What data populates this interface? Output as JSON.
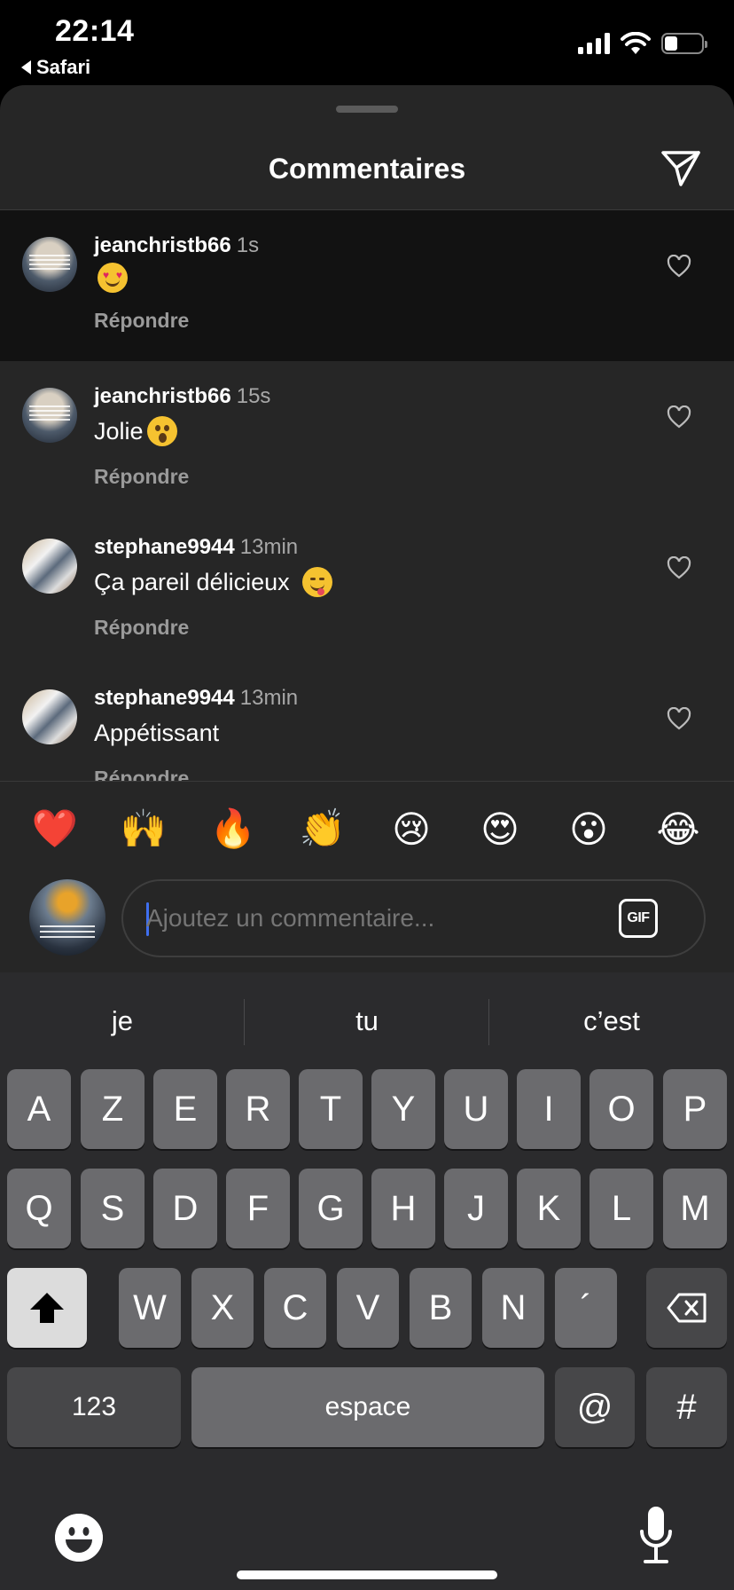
{
  "status_bar": {
    "time": "22:14",
    "back_app": "Safari",
    "battery_level": 0.35
  },
  "sheet": {
    "title": "Commentaires",
    "comments": [
      {
        "user": "jeanchristb66",
        "time": "1s",
        "text": "",
        "emoji": "heart-eyes",
        "reply": "Répondre",
        "highlighted": true
      },
      {
        "user": "jeanchristb66",
        "time": "15s",
        "text": "Jolie",
        "emoji": "hushed",
        "reply": "Répondre"
      },
      {
        "user": "stephane9944",
        "time": "13min",
        "text": "Ça pareil délicieux",
        "emoji": "yum",
        "reply": "Répondre"
      },
      {
        "user": "stephane9944",
        "time": "13min",
        "text": "Appétissant",
        "emoji": "",
        "reply": "Répondre"
      }
    ],
    "reactions": [
      "❤️",
      "🙌",
      "🔥",
      "👏",
      "😢",
      "😍",
      "😮",
      "😂"
    ],
    "composer": {
      "placeholder": "Ajoutez un commentaire...",
      "gif_label": "GIF"
    }
  },
  "keyboard": {
    "suggestions": [
      "je",
      "tu",
      "c’est"
    ],
    "row1": [
      "A",
      "Z",
      "E",
      "R",
      "T",
      "Y",
      "U",
      "I",
      "O",
      "P"
    ],
    "row2": [
      "Q",
      "S",
      "D",
      "F",
      "G",
      "H",
      "J",
      "K",
      "L",
      "M"
    ],
    "row3": [
      "W",
      "X",
      "C",
      "V",
      "B",
      "N",
      "´"
    ],
    "numbers_label": "123",
    "space_label": "espace",
    "at_label": "@",
    "hash_label": "#"
  }
}
